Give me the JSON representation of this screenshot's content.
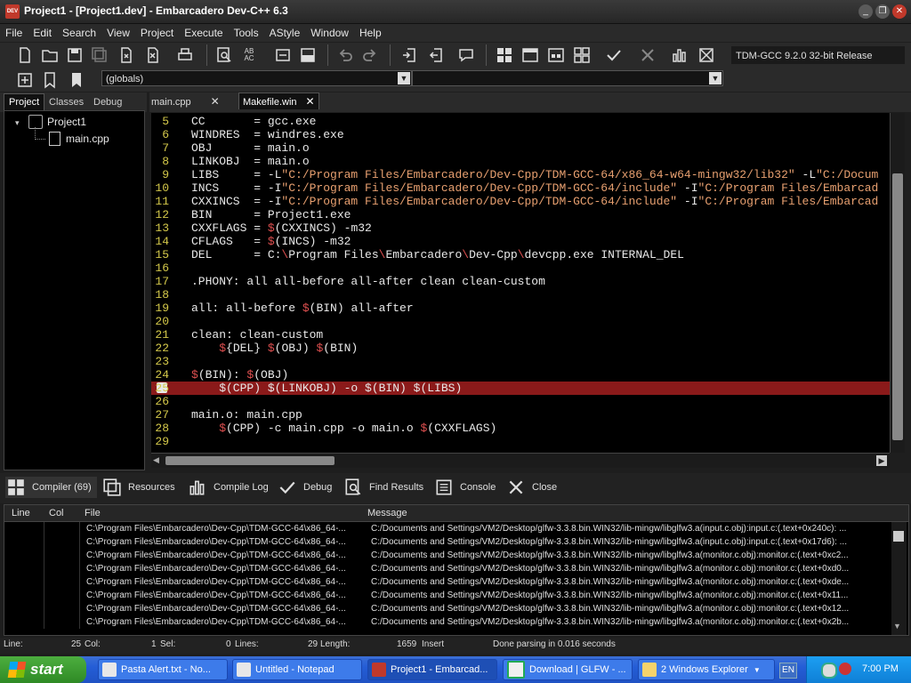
{
  "window": {
    "title": "Project1 - [Project1.dev] - Embarcadero Dev-C++ 6.3",
    "app_icon": "devcpp-icon"
  },
  "menu": [
    "File",
    "Edit",
    "Search",
    "View",
    "Project",
    "Execute",
    "Tools",
    "AStyle",
    "Window",
    "Help"
  ],
  "toolbar": {
    "compiler_select": "TDM-GCC 9.2.0 32-bit Release",
    "scope_select": "(globals)",
    "function_select": ""
  },
  "left_panel": {
    "tabs": [
      "Project",
      "Classes",
      "Debug"
    ],
    "active_tab": "Project",
    "tree": {
      "root": "Project1",
      "children": [
        "main.cpp"
      ]
    }
  },
  "editor": {
    "tabs": [
      "main.cpp",
      "Makefile.win"
    ],
    "active_tab": "Makefile.win",
    "lines": [
      {
        "n": "5",
        "segs": [
          [
            "t",
            "CC       = gcc.exe"
          ]
        ]
      },
      {
        "n": "6",
        "segs": [
          [
            "t",
            "WINDRES  = windres.exe"
          ]
        ]
      },
      {
        "n": "7",
        "segs": [
          [
            "t",
            "OBJ      = main.o"
          ]
        ]
      },
      {
        "n": "8",
        "segs": [
          [
            "t",
            "LINKOBJ  = main.o"
          ]
        ]
      },
      {
        "n": "9",
        "segs": [
          [
            "t",
            "LIBS     = -L"
          ],
          [
            "s",
            "\"C:/Program Files/Embarcadero/Dev-Cpp/TDM-GCC-64/x86_64-w64-mingw32/lib32\""
          ],
          [
            "t",
            " -L"
          ],
          [
            "s",
            "\"C:/Docum"
          ]
        ]
      },
      {
        "n": "10",
        "segs": [
          [
            "t",
            "INCS     = -I"
          ],
          [
            "s",
            "\"C:/Program Files/Embarcadero/Dev-Cpp/TDM-GCC-64/include\""
          ],
          [
            "t",
            " -I"
          ],
          [
            "s",
            "\"C:/Program Files/Embarcad"
          ]
        ]
      },
      {
        "n": "11",
        "segs": [
          [
            "t",
            "CXXINCS  = -I"
          ],
          [
            "s",
            "\"C:/Program Files/Embarcadero/Dev-Cpp/TDM-GCC-64/include\""
          ],
          [
            "t",
            " -I"
          ],
          [
            "s",
            "\"C:/Program Files/Embarcad"
          ]
        ]
      },
      {
        "n": "12",
        "segs": [
          [
            "t",
            "BIN      = Project1.exe"
          ]
        ]
      },
      {
        "n": "13",
        "segs": [
          [
            "t",
            "CXXFLAGS = "
          ],
          [
            "d",
            "$"
          ],
          [
            "t",
            "(CXXINCS) -m32"
          ]
        ]
      },
      {
        "n": "14",
        "segs": [
          [
            "t",
            "CFLAGS   = "
          ],
          [
            "d",
            "$"
          ],
          [
            "t",
            "(INCS) -m32"
          ]
        ]
      },
      {
        "n": "15",
        "segs": [
          [
            "t",
            "DEL      = C:"
          ],
          [
            "d",
            "\\"
          ],
          [
            "t",
            "Program Files"
          ],
          [
            "d",
            "\\"
          ],
          [
            "t",
            "Embarcadero"
          ],
          [
            "d",
            "\\"
          ],
          [
            "t",
            "Dev-Cpp"
          ],
          [
            "d",
            "\\"
          ],
          [
            "t",
            "devcpp.exe INTERNAL_DEL"
          ]
        ]
      },
      {
        "n": "16",
        "segs": [
          [
            "t",
            ""
          ]
        ]
      },
      {
        "n": "17",
        "segs": [
          [
            "t",
            ".PHONY: all all-before all-after clean clean-custom"
          ]
        ]
      },
      {
        "n": "18",
        "segs": [
          [
            "t",
            ""
          ]
        ]
      },
      {
        "n": "19",
        "segs": [
          [
            "t",
            "all: all-before "
          ],
          [
            "d",
            "$"
          ],
          [
            "t",
            "(BIN) all-after"
          ]
        ]
      },
      {
        "n": "20",
        "segs": [
          [
            "t",
            ""
          ]
        ]
      },
      {
        "n": "21",
        "segs": [
          [
            "t",
            "clean: clean-custom"
          ]
        ]
      },
      {
        "n": "22",
        "segs": [
          [
            "t",
            "    "
          ],
          [
            "d",
            "$"
          ],
          [
            "t",
            "{DEL} "
          ],
          [
            "d",
            "$"
          ],
          [
            "t",
            "(OBJ) "
          ],
          [
            "d",
            "$"
          ],
          [
            "t",
            "(BIN)"
          ]
        ]
      },
      {
        "n": "23",
        "segs": [
          [
            "t",
            ""
          ]
        ]
      },
      {
        "n": "24",
        "segs": [
          [
            "d",
            "$"
          ],
          [
            "t",
            "(BIN): "
          ],
          [
            "d",
            "$"
          ],
          [
            "t",
            "(OBJ)"
          ]
        ]
      },
      {
        "n": "25",
        "err": true,
        "segs": [
          [
            "t",
            "    $(CPP) $(LINKOBJ) -o $(BIN) $(LIBS)"
          ]
        ]
      },
      {
        "n": "26",
        "segs": [
          [
            "t",
            ""
          ]
        ]
      },
      {
        "n": "27",
        "segs": [
          [
            "t",
            "main.o: main.cpp"
          ]
        ]
      },
      {
        "n": "28",
        "segs": [
          [
            "t",
            "    "
          ],
          [
            "d",
            "$"
          ],
          [
            "t",
            "(CPP) -c main.cpp -o main.o "
          ],
          [
            "d",
            "$"
          ],
          [
            "t",
            "(CXXFLAGS)"
          ]
        ]
      },
      {
        "n": "29",
        "segs": [
          [
            "t",
            ""
          ]
        ]
      }
    ]
  },
  "bottom_tabs": [
    "Compiler (69)",
    "Resources",
    "Compile Log",
    "Debug",
    "Find Results",
    "Console",
    "Close"
  ],
  "messages": {
    "columns": [
      "Line",
      "Col",
      "File",
      "Message"
    ],
    "rows": [
      {
        "file": "C:\\Program Files\\Embarcadero\\Dev-Cpp\\TDM-GCC-64\\x86_64-...",
        "msg": "C:/Documents and Settings/VM2/Desktop/glfw-3.3.8.bin.WIN32/lib-mingw/libglfw3.a(input.c.obj):input.c:(.text+0x240c): ..."
      },
      {
        "file": "C:\\Program Files\\Embarcadero\\Dev-Cpp\\TDM-GCC-64\\x86_64-...",
        "msg": "C:/Documents and Settings/VM2/Desktop/glfw-3.3.8.bin.WIN32/lib-mingw/libglfw3.a(input.c.obj):input.c:(.text+0x17d6): ..."
      },
      {
        "file": "C:\\Program Files\\Embarcadero\\Dev-Cpp\\TDM-GCC-64\\x86_64-...",
        "msg": "C:/Documents and Settings/VM2/Desktop/glfw-3.3.8.bin.WIN32/lib-mingw/libglfw3.a(monitor.c.obj):monitor.c:(.text+0xc2..."
      },
      {
        "file": "C:\\Program Files\\Embarcadero\\Dev-Cpp\\TDM-GCC-64\\x86_64-...",
        "msg": "C:/Documents and Settings/VM2/Desktop/glfw-3.3.8.bin.WIN32/lib-mingw/libglfw3.a(monitor.c.obj):monitor.c:(.text+0xd0..."
      },
      {
        "file": "C:\\Program Files\\Embarcadero\\Dev-Cpp\\TDM-GCC-64\\x86_64-...",
        "msg": "C:/Documents and Settings/VM2/Desktop/glfw-3.3.8.bin.WIN32/lib-mingw/libglfw3.a(monitor.c.obj):monitor.c:(.text+0xde..."
      },
      {
        "file": "C:\\Program Files\\Embarcadero\\Dev-Cpp\\TDM-GCC-64\\x86_64-...",
        "msg": "C:/Documents and Settings/VM2/Desktop/glfw-3.3.8.bin.WIN32/lib-mingw/libglfw3.a(monitor.c.obj):monitor.c:(.text+0x11..."
      },
      {
        "file": "C:\\Program Files\\Embarcadero\\Dev-Cpp\\TDM-GCC-64\\x86_64-...",
        "msg": "C:/Documents and Settings/VM2/Desktop/glfw-3.3.8.bin.WIN32/lib-mingw/libglfw3.a(monitor.c.obj):monitor.c:(.text+0x12..."
      },
      {
        "file": "C:\\Program Files\\Embarcadero\\Dev-Cpp\\TDM-GCC-64\\x86_64-...",
        "msg": "C:/Documents and Settings/VM2/Desktop/glfw-3.3.8.bin.WIN32/lib-mingw/libglfw3.a(monitor.c.obj):monitor.c:(.text+0x2b..."
      }
    ]
  },
  "status": {
    "line_label": "Line:",
    "line": "25",
    "col_label": "Col:",
    "col": "1",
    "sel_label": "Sel:",
    "sel": "0",
    "lines_label": "Lines:",
    "lines": "29",
    "length_label": "Length:",
    "length": "1659",
    "mode": "Insert",
    "message": "Done parsing in 0.016 seconds"
  },
  "taskbar": {
    "start": "start",
    "tasks": [
      "Pasta Alert.txt - No...",
      "Untitled - Notepad",
      "Project1 - Embarcad...",
      "Download | GLFW - ...",
      "2 Windows Explorer"
    ],
    "active_task": 2,
    "lang": "EN",
    "clock": "7:00 PM"
  },
  "colors": {
    "error_line": "#8b1a1a",
    "line_numbers": "#d4c84a",
    "string": "#e8a070",
    "dollar": "#e05050"
  }
}
